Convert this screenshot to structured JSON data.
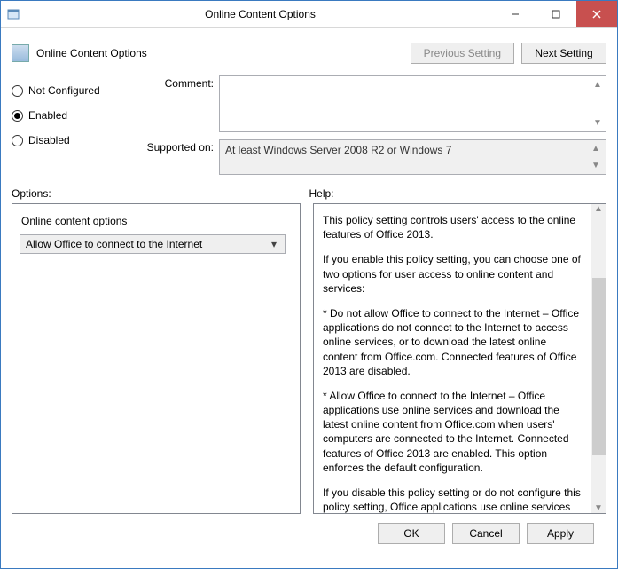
{
  "window": {
    "title": "Online Content Options"
  },
  "header": {
    "title": "Online Content Options",
    "prev_label": "Previous Setting",
    "next_label": "Next Setting"
  },
  "state": {
    "not_configured": "Not Configured",
    "enabled": "Enabled",
    "disabled": "Disabled",
    "selected": "enabled"
  },
  "fields": {
    "comment_label": "Comment:",
    "comment_value": "",
    "supported_label": "Supported on:",
    "supported_value": "At least Windows Server 2008 R2 or Windows 7"
  },
  "sections": {
    "options_label": "Options:",
    "help_label": "Help:"
  },
  "options_panel": {
    "group_title": "Online content options",
    "dropdown_value": "Allow Office to connect to the Internet"
  },
  "help_panel": {
    "p1": "This policy setting controls users' access to the online features of Office 2013.",
    "p2": "If you enable this policy setting, you can choose one of two options for user access to online content and services:",
    "p3": "* Do not allow Office to connect to the Internet – Office applications do not connect to the Internet to access online services, or to download the latest online content from Office.com. Connected features of Office 2013 are disabled.",
    "p4": "* Allow Office to connect to the Internet – Office applications use online services and download the latest online content from Office.com when users' computers are connected to the Internet. Connected features of Office 2013 are enabled. This option enforces the default configuration.",
    "p5": "If you disable this policy setting or do not configure this policy setting, Office applications use online services and download the latest online content from Office.com when users' computers are connected to the Internet. Users can change this behavior by"
  },
  "footer": {
    "ok": "OK",
    "cancel": "Cancel",
    "apply": "Apply"
  }
}
